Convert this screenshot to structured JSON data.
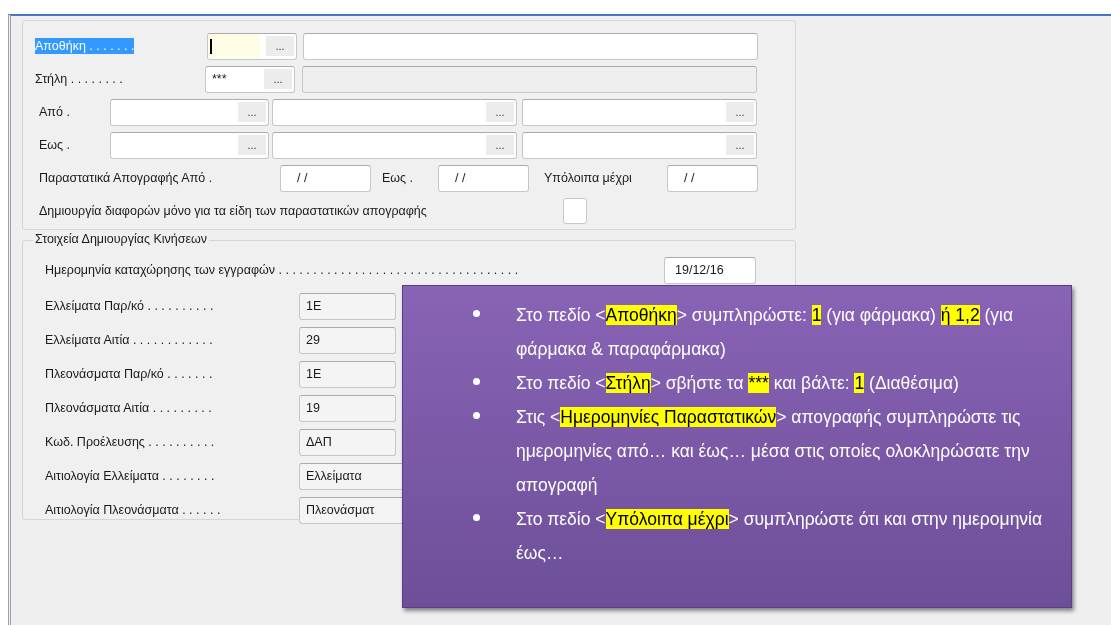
{
  "criteria": {
    "warehouse": {
      "label": "Αποθήκη . . . . . . .",
      "selected": true,
      "code": {
        "focused": true,
        "button": "..."
      },
      "description": {
        "disabled": false
      }
    },
    "column": {
      "label": "Στήλη . . . . . . . .",
      "selected": false,
      "code": {
        "value": "***",
        "focused": false,
        "button": "..."
      },
      "description": {
        "disabled": true
      }
    },
    "range_rows": [
      {
        "label": "Από .",
        "fields": [
          {
            "button": "..."
          },
          {
            "button": "..."
          },
          {
            "button": "..."
          }
        ]
      },
      {
        "label": "Εως .",
        "fields": [
          {
            "button": "..."
          },
          {
            "button": "..."
          },
          {
            "button": "..."
          }
        ]
      }
    ],
    "dates": [
      {
        "label": "Παραστατικά Απογραφής Από .",
        "value": "/ /"
      },
      {
        "label": "Εως .",
        "value": "/ /"
      },
      {
        "label": "Υπόλοιπα μέχρι",
        "value": "/ /"
      }
    ],
    "only_doc_types": {
      "label": "Δημιουργία διαφορών μόνο για τα είδη των παραστατικών απογραφής",
      "checked": false
    }
  },
  "movements": {
    "title": "Στοιχεία Δημιουργίας Κινήσεων",
    "posting_date": {
      "label": "Ημερομηνία καταχώρησης των εγγραφών . . . . . . . . . . . . . . . . . . . . . . . . . . . . . . . . . . .",
      "value": "19/12/16"
    },
    "rows": [
      {
        "label": "Ελλείματα Παρ/κό . . . . . . . . . .",
        "value": "1E",
        "kind": "short"
      },
      {
        "label": "Ελλείματα Αιτία . . . . . . . . . . . .",
        "value": "29",
        "kind": "short"
      },
      {
        "label": "Πλεονάσματα Παρ/κό . . . . . . .",
        "value": "1E",
        "kind": "short"
      },
      {
        "label": "Πλεονάσματα Αιτία . . . . . . . . .",
        "value": "19",
        "kind": "short"
      },
      {
        "label": "Κωδ. Προέλευσης . . . . . . . . . .",
        "value": "ΔΑΠ",
        "kind": "short"
      },
      {
        "label": "Αιτιολογία Ελλείματα . . . . . . . .",
        "value": "Ελλείματα",
        "kind": "wide"
      },
      {
        "label": "Αιτιολογία Πλεονάσματα . . . . . .",
        "value": "Πλεονάσματ",
        "kind": "wide"
      }
    ]
  },
  "callout": {
    "items": [
      {
        "segments": [
          {
            "text": "Στο πεδίο <",
            "highlighted": false
          },
          {
            "text": "Αποθήκη",
            "highlighted": true
          },
          {
            "text": "> συμπληρώστε: ",
            "highlighted": false
          },
          {
            "text": "1",
            "highlighted": true
          },
          {
            "text": " (για φάρμακα) ",
            "highlighted": false
          },
          {
            "text": "ή 1,2",
            "highlighted": true
          },
          {
            "text": " (για φάρμακα & παραφάρμακα)",
            "highlighted": false
          }
        ]
      },
      {
        "segments": [
          {
            "text": "Στο πεδίο <",
            "highlighted": false
          },
          {
            "text": "Στήλη",
            "highlighted": true
          },
          {
            "text": "> σβήστε τα ",
            "highlighted": false
          },
          {
            "text": "***",
            "highlighted": true
          },
          {
            "text": " και βάλτε: ",
            "highlighted": false
          },
          {
            "text": "1",
            "highlighted": true
          },
          {
            "text": " (Διαθέσιμα)",
            "highlighted": false
          }
        ]
      },
      {
        "segments": [
          {
            "text": "Στις <",
            "highlighted": false
          },
          {
            "text": "Ημερομηνίες Παραστατικών",
            "highlighted": true
          },
          {
            "text": "> απογραφής συμπληρώστε τις ημερομηνίες από… και έως… μέσα στις οποίες ολοκληρώσατε την απογραφή",
            "highlighted": false
          }
        ]
      },
      {
        "segments": [
          {
            "text": "Στο πεδίο <",
            "highlighted": false
          },
          {
            "text": "Υπόλοιπα μέχρι",
            "highlighted": true
          },
          {
            "text": "> συμπληρώστε ότι και στην ημερομηνία έως…",
            "highlighted": false
          }
        ]
      }
    ]
  }
}
